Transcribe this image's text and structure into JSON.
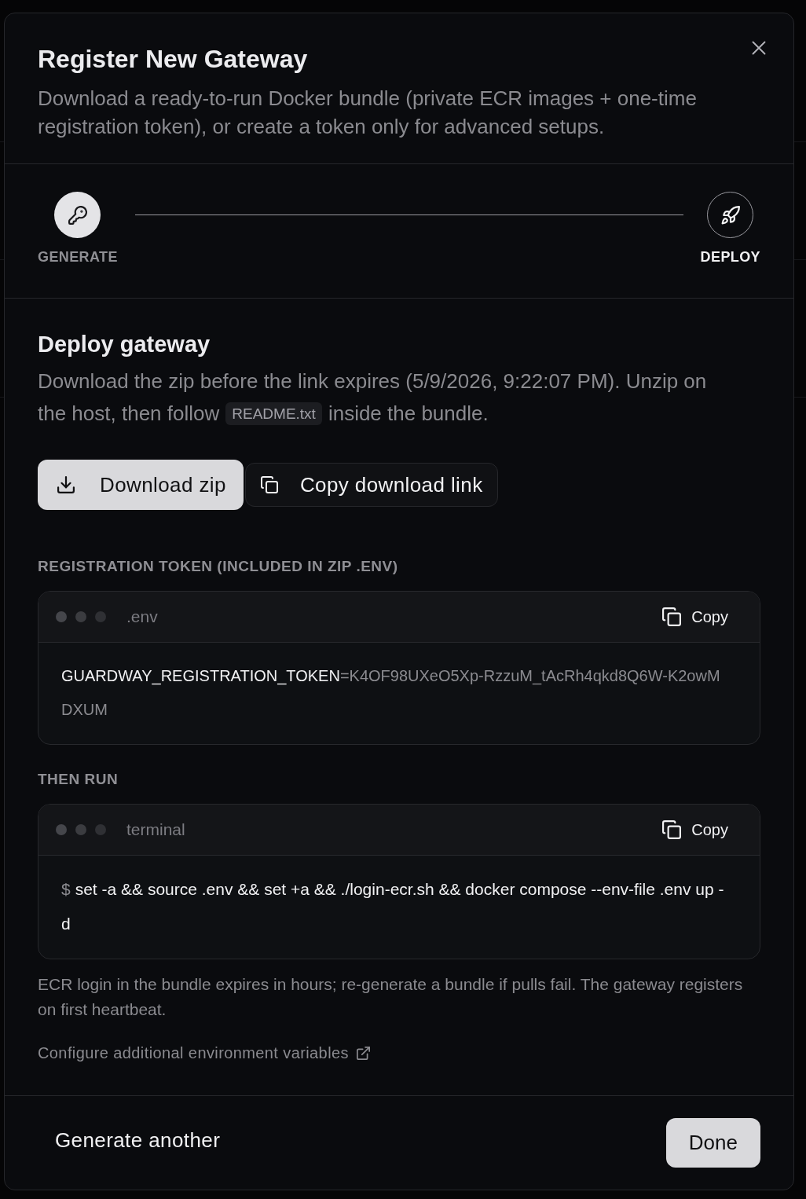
{
  "dialog": {
    "title": "Register New Gateway",
    "description": "Download a ready-to-run Docker bundle (private ECR images + one-time registration token), or create a token only for advanced setups."
  },
  "stepper": {
    "steps": [
      {
        "label": "GENERATE",
        "completed": true,
        "current": false
      },
      {
        "label": "DEPLOY",
        "completed": false,
        "current": true
      }
    ]
  },
  "deploy": {
    "title": "Deploy gateway",
    "description": [
      {
        "kind": "text",
        "text": "Download the zip before the link expires (5/9/2026, 9:22:07 PM). Unzip on the host, then follow"
      },
      {
        "kind": "file",
        "text": "README.txt"
      },
      {
        "kind": "text",
        "text": "inside the bundle."
      }
    ],
    "actions": [
      {
        "label": "Download zip",
        "kind": "primary"
      },
      {
        "label": "Copy download link",
        "kind": "secondary"
      }
    ],
    "code_blocks": [
      {
        "heading": "REGISTRATION TOKEN (INCLUDED IN ZIP .ENV)",
        "title": ".env",
        "copy_label": "Copy",
        "segments": [
          {
            "kind": "key",
            "text": "GUARDWAY_REGISTRATION_TOKEN"
          },
          {
            "kind": "value",
            "text": "=K4OF98UXeO5Xp-RzzuM_tAcRh4qkd8Q6W-K2owMDXUM"
          }
        ]
      },
      {
        "heading": "THEN RUN",
        "title": "terminal",
        "copy_label": "Copy",
        "segments": [
          {
            "kind": "prompt",
            "text": "$"
          },
          {
            "kind": "command",
            "text": "set -a && source .env && set +a && ./login-ecr.sh && docker compose --env-file .env up -d"
          }
        ]
      }
    ],
    "note": "ECR login in the bundle expires in hours; re-generate a bundle if pulls fail. The gateway registers on first heartbeat.",
    "link": "Configure additional environment variables"
  },
  "footer": {
    "buttons": [
      {
        "label": "Generate another",
        "kind": "ghost"
      },
      {
        "label": "Done",
        "kind": "primary"
      }
    ]
  }
}
